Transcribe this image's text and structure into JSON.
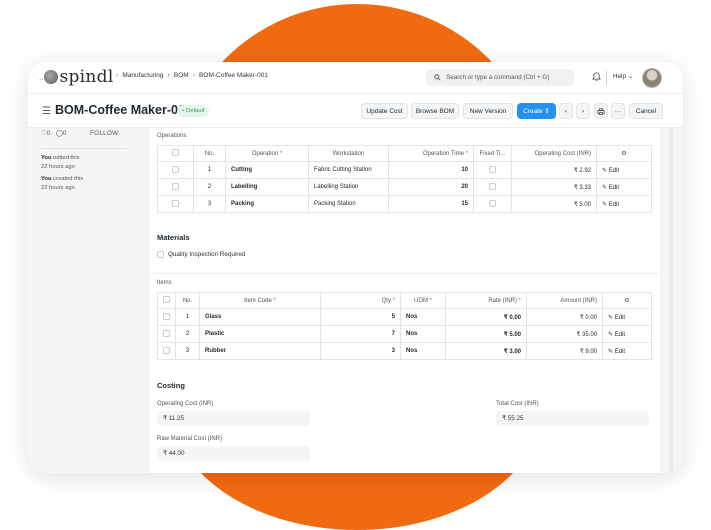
{
  "navbar": {
    "logo_text": "spindl",
    "breadcrumbs": [
      "Manufacturing",
      "BOM",
      "BOM-Coffee Maker-001"
    ],
    "search_placeholder": "Search or type a command (Ctrl + G)",
    "help_label": "Help"
  },
  "header": {
    "title": "BOM-Coffee Maker-001",
    "status_badge": "Default",
    "buttons": {
      "update_cost": "Update Cost",
      "browse_bom": "Browse BOM",
      "new_version": "New Version",
      "create": "Create",
      "more": "···",
      "cancel": "Cancel"
    }
  },
  "sidebar": {
    "likes": "0",
    "comments": "0",
    "follow": "FOLLOW",
    "activity": [
      {
        "actor": "You",
        "action": " edited this",
        "time": "22 hours ago"
      },
      {
        "actor": "You",
        "action": " created this",
        "time": "22 hours ago"
      }
    ]
  },
  "operations": {
    "label": "Operations",
    "columns": [
      "No.",
      "Operation",
      "Workstation",
      "Operation Time",
      "Fixed Ti...",
      "Operating Cost (INR)"
    ],
    "rows": [
      {
        "no": "1",
        "operation": "Cutting",
        "workstation": "Fabric Cutting Station",
        "time": "10",
        "cost": "₹ 2.92",
        "edit": "Edit"
      },
      {
        "no": "2",
        "operation": "Labelling",
        "workstation": "Labelling Station",
        "time": "20",
        "cost": "₹ 3.33",
        "edit": "Edit"
      },
      {
        "no": "3",
        "operation": "Packing",
        "workstation": "Packing Station",
        "time": "15",
        "cost": "₹ 5.00",
        "edit": "Edit"
      }
    ]
  },
  "materials": {
    "title": "Materials",
    "quality_inspection": "Quality Inspection Required"
  },
  "items": {
    "label": "Items",
    "columns": [
      "No.",
      "Item Code",
      "Qty",
      "UOM",
      "Rate (INR)",
      "Amount (INR)"
    ],
    "rows": [
      {
        "no": "1",
        "item_code": "Glass",
        "qty": "5",
        "uom": "Nos",
        "rate": "₹ 0.00",
        "amount": "₹ 0.00",
        "edit": "Edit"
      },
      {
        "no": "2",
        "item_code": "Plastic",
        "qty": "7",
        "uom": "Nos",
        "rate": "₹ 5.00",
        "amount": "₹ 35.00",
        "edit": "Edit"
      },
      {
        "no": "3",
        "item_code": "Rubber",
        "qty": "3",
        "uom": "Nos",
        "rate": "₹ 3.00",
        "amount": "₹ 9.00",
        "edit": "Edit"
      }
    ]
  },
  "costing": {
    "title": "Costing",
    "operating_cost_label": "Operating Cost (INR)",
    "operating_cost_value": "₹ 11.25",
    "total_cost_label": "Total Cost (INR)",
    "total_cost_value": "₹ 55.25",
    "raw_material_cost_label": "Raw Material Cost (INR)",
    "raw_material_cost_value": "₹ 44.00"
  },
  "colors": {
    "brand_orange": "#f06a12",
    "primary_blue": "#2490ef",
    "badge_green": "#2f9d58"
  }
}
